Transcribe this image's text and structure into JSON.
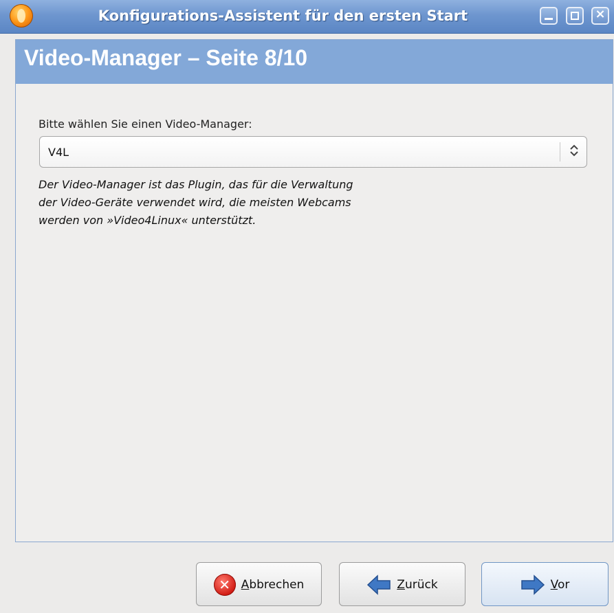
{
  "window": {
    "title": "Konfigurations-Assistent für den ersten Start",
    "controls": {
      "minimize": "minimize",
      "maximize": "maximize",
      "close": "x"
    }
  },
  "page": {
    "title": "Video-Manager – Seite 8/10",
    "prompt": "Bitte wählen Sie einen Video-Manager:",
    "video_manager_select": {
      "value": "V4L"
    },
    "description": "Der Video-Manager ist das Plugin, das für die Verwaltung der Video-Geräte verwendet wird, die meisten Webcams werden von »Video4Linux« unterstützt."
  },
  "buttons": {
    "cancel": {
      "mnemonic": "A",
      "rest": "bbrechen"
    },
    "back": {
      "mnemonic": "Z",
      "rest": "urück"
    },
    "next": {
      "mnemonic": "V",
      "rest": "or"
    }
  },
  "icons": {
    "app": "app-orb-icon",
    "cancel": "cancel-x-icon",
    "back": "arrow-left-icon",
    "next": "arrow-right-icon"
  },
  "colors": {
    "titlebar": "#6e96cf",
    "page_header": "#83a8d8",
    "arrow_blue": "#3f78c4",
    "cancel_red": "#d11b13"
  }
}
